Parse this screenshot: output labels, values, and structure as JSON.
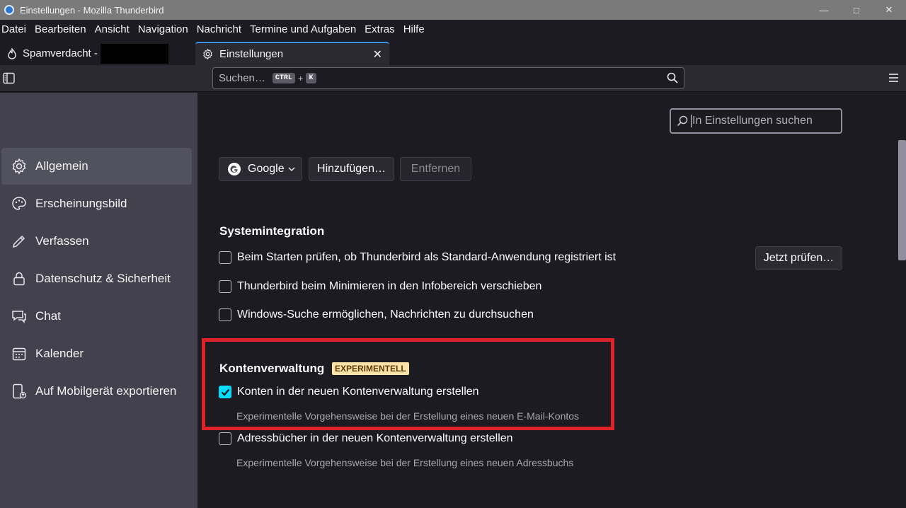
{
  "window": {
    "title": "Einstellungen - Mozilla Thunderbird"
  },
  "menubar": {
    "items": [
      "Datei",
      "Bearbeiten",
      "Ansicht",
      "Navigation",
      "Nachricht",
      "Termine und Aufgaben",
      "Extras",
      "Hilfe"
    ]
  },
  "tabs": [
    {
      "label": "Spamverdacht -",
      "icon": "flame-icon"
    },
    {
      "label": "Einstellungen",
      "icon": "gear-icon"
    }
  ],
  "toolbar": {
    "search_placeholder": "Suchen…",
    "shortcut_key1": "CTRL",
    "shortcut_plus": "+",
    "shortcut_key2": "K"
  },
  "sidebar": {
    "items": [
      {
        "label": "Allgemein",
        "icon": "gear-icon"
      },
      {
        "label": "Erscheinungsbild",
        "icon": "palette-icon"
      },
      {
        "label": "Verfassen",
        "icon": "pencil-icon"
      },
      {
        "label": "Datenschutz & Sicherheit",
        "icon": "lock-icon"
      },
      {
        "label": "Chat",
        "icon": "chat-icon"
      },
      {
        "label": "Kalender",
        "icon": "calendar-icon"
      },
      {
        "label": "Auf Mobilgerät exportieren",
        "icon": "mobile-export-icon"
      }
    ]
  },
  "main": {
    "find_placeholder": "In Einstellungen suchen",
    "search_engine": {
      "selected": "Google",
      "add_label": "Hinzufügen…",
      "remove_label": "Entfernen"
    },
    "system_integration": {
      "heading": "Systemintegration",
      "check_default": {
        "label": "Beim Starten prüfen, ob Thunderbird als Standard-Anwendung registriert ist",
        "checked": false
      },
      "check_now_label": "Jetzt prüfen…",
      "minimize_tray": {
        "label": "Thunderbird beim Minimieren in den Infobereich verschieben",
        "checked": false
      },
      "windows_search": {
        "label": "Windows-Suche ermöglichen, Nachrichten zu durchsuchen",
        "checked": false
      }
    },
    "account_management": {
      "heading": "Kontenverwaltung",
      "badge": "EXPERIMENTELL",
      "new_accounts": {
        "label": "Konten in der neuen Kontenverwaltung erstellen",
        "checked": true,
        "description": "Experimentelle Vorgehensweise bei der Erstellung eines neuen E-Mail-Kontos"
      },
      "address_books": {
        "label": "Adressbücher in der neuen Kontenverwaltung erstellen",
        "checked": false,
        "description": "Experimentelle Vorgehensweise bei der Erstellung eines neuen Adressbuchs"
      }
    }
  },
  "colors": {
    "accent": "#00ddff",
    "highlight_box": "#e0232b",
    "badge_bg": "#ffe3a8"
  }
}
